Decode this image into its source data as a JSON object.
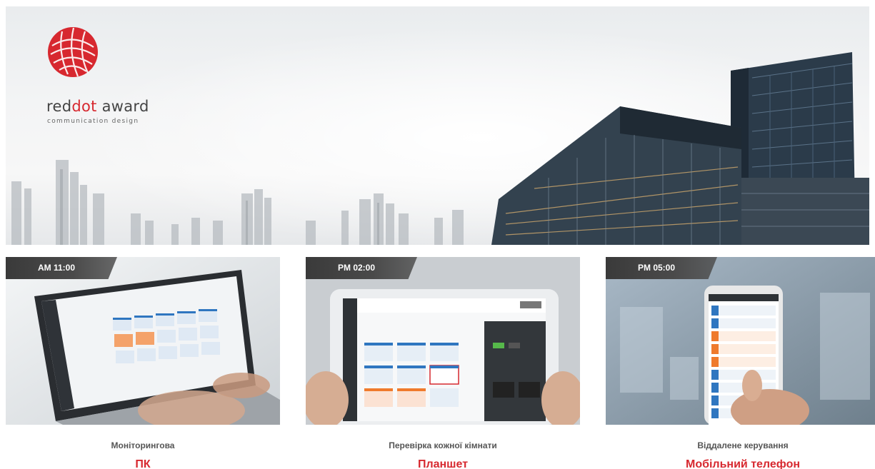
{
  "hero": {
    "logo_icon": "reddot-logo-icon",
    "award_prefix": "red",
    "award_dot": "dot",
    "award_suffix": " award",
    "award_sub": "communication design"
  },
  "colors": {
    "accent": "#d7282f",
    "badge": "#444444",
    "caption": "#555555"
  },
  "cards": [
    {
      "time": "AM 11:00",
      "caption": "Моніторингова",
      "title": "ПК",
      "device_icon": "laptop-icon"
    },
    {
      "time": "PM 02:00",
      "caption": "Перевірка кожної кімнати",
      "title": "Планшет",
      "device_icon": "tablet-icon"
    },
    {
      "time": "PM 05:00",
      "caption": "Віддалене керування",
      "title": "Мобільний телефон",
      "device_icon": "smartphone-icon"
    }
  ]
}
